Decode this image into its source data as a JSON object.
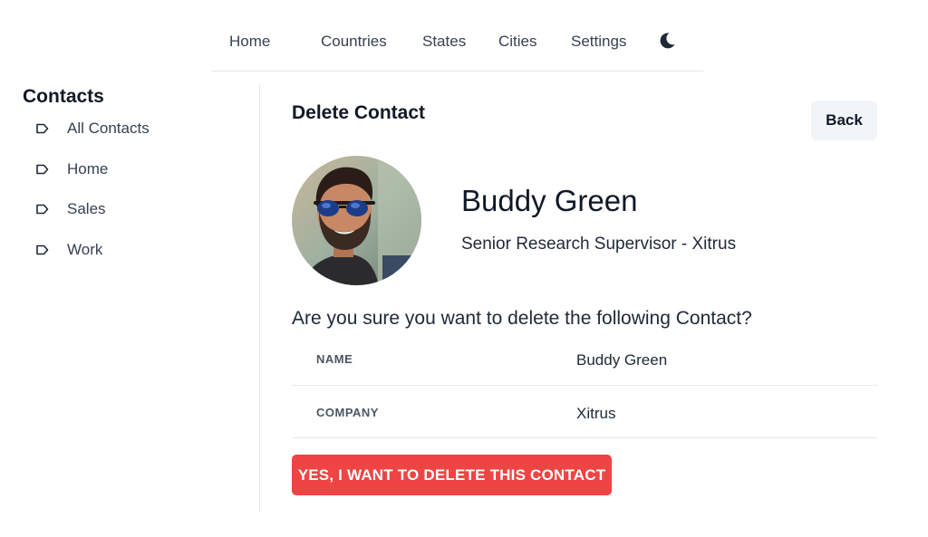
{
  "nav": {
    "home": "Home",
    "countries": "Countries",
    "states": "States",
    "cities": "Cities",
    "settings": "Settings",
    "theme_icon": "moon-icon"
  },
  "sidebar": {
    "title": "Contacts",
    "item_icon": "tag-icon",
    "items": [
      {
        "label": "All Contacts"
      },
      {
        "label": "Home"
      },
      {
        "label": "Sales"
      },
      {
        "label": "Work"
      }
    ]
  },
  "main": {
    "title": "Delete Contact",
    "back_label": "Back",
    "contact": {
      "name": "Buddy Green",
      "subtitle": "Senior Research Supervisor - Xitrus"
    },
    "question": "Are you sure you want to delete the following Contact?",
    "details": [
      {
        "label": "NAME",
        "value": "Buddy Green"
      },
      {
        "label": "COMPANY",
        "value": "Xitrus"
      }
    ],
    "delete_label": "YES, I WANT TO DELETE THIS CONTACT"
  },
  "colors": {
    "danger": "#ef4444",
    "back_bg": "#f1f4f8",
    "divider": "#e5e7eb"
  }
}
